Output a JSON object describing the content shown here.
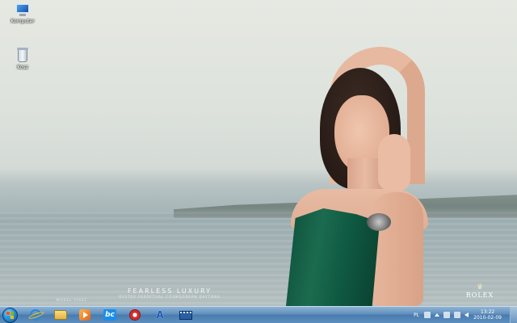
{
  "desktop": {
    "icons": [
      {
        "label": "Komputer",
        "icon": "computer-icon"
      },
      {
        "label": "Kosz",
        "icon": "recycle-bin-icon"
      }
    ],
    "wallpaper": {
      "headline": "FEARLESS LUXURY",
      "subline": "OYSTER PERPETUAL COSMOGRAPH DAYTONA",
      "credit": "MODEL FIRST",
      "brand": "ROLEX"
    }
  },
  "taskbar": {
    "pinned": [
      {
        "name": "internet-explorer",
        "icon": "ie-icon"
      },
      {
        "name": "windows-explorer",
        "icon": "folder-icon"
      },
      {
        "name": "media-player",
        "icon": "media-icon"
      },
      {
        "name": "bc",
        "icon": "bc-icon",
        "text": "bc"
      },
      {
        "name": "red-app",
        "icon": "red-app-icon"
      },
      {
        "name": "a-app",
        "icon": "a-icon",
        "text": "A"
      },
      {
        "name": "film-app",
        "icon": "film-icon"
      }
    ],
    "tray": {
      "language": "PL",
      "time": "13:22",
      "date": "2010-02-09"
    }
  }
}
